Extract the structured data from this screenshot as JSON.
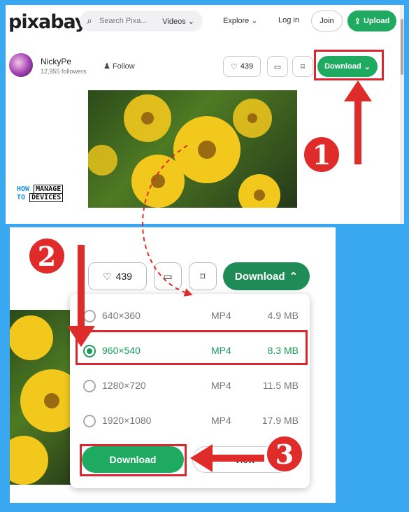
{
  "topbar": {
    "logo": "pixabay",
    "search_placeholder": "Search Pixa...",
    "search_scope": "Videos",
    "explore": "Explore",
    "login": "Log in",
    "join": "Join",
    "upload": "Upload"
  },
  "author": {
    "name": "NickyPe",
    "followers": "12,955 followers",
    "follow": "Follow"
  },
  "actions": {
    "likes": "439",
    "download": "Download"
  },
  "watermark": {
    "how": "HOW",
    "to": "TO",
    "manage": "MANAGE",
    "devices": "DEVICES"
  },
  "dropdown": {
    "options": [
      {
        "resolution": "640×360",
        "format": "MP4",
        "size": "4.9 MB",
        "selected": false
      },
      {
        "resolution": "960×540",
        "format": "MP4",
        "size": "8.3 MB",
        "selected": true
      },
      {
        "resolution": "1280×720",
        "format": "MP4",
        "size": "11.5 MB",
        "selected": false
      },
      {
        "resolution": "1920×1080",
        "format": "MP4",
        "size": "17.9 MB",
        "selected": false
      }
    ],
    "download": "Download",
    "view": "View"
  },
  "steps": [
    "1",
    "2",
    "3"
  ],
  "colors": {
    "brand_green": "#1eab61",
    "highlight_red": "#d8272e",
    "background_blue": "#3aa8f0"
  }
}
